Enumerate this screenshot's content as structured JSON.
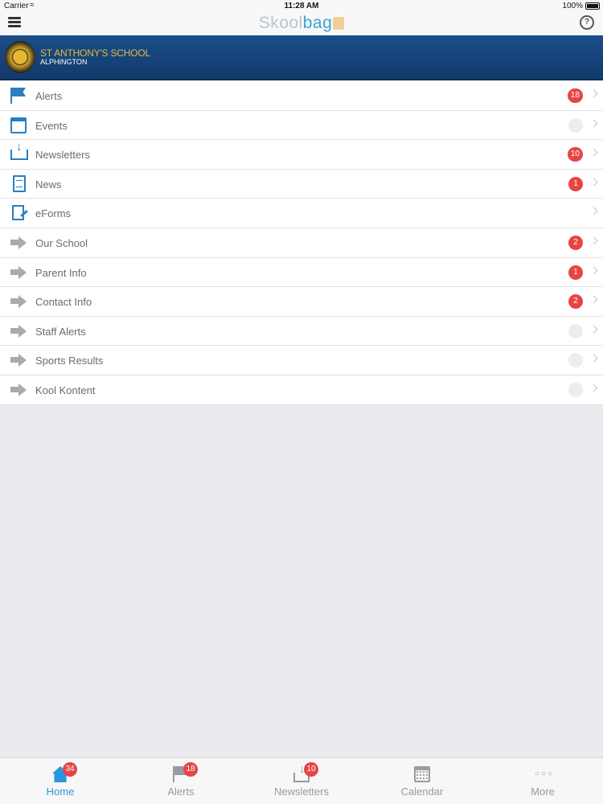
{
  "status_bar": {
    "carrier": "Carrier",
    "time": "11:28 AM",
    "battery": "100%"
  },
  "nav": {
    "logo_part1": "Skool",
    "logo_part2": "bag",
    "menu_icon": "hamburger-icon",
    "help_icon": "help-icon"
  },
  "school": {
    "name": "ST ANTHONY'S SCHOOL",
    "suburb": "ALPHINGTON"
  },
  "menu": [
    {
      "label": "Alerts",
      "icon": "flag-icon",
      "badge": "18"
    },
    {
      "label": "Events",
      "icon": "calendar-icon",
      "badge": ""
    },
    {
      "label": "Newsletters",
      "icon": "inbox-download-icon",
      "badge": "10"
    },
    {
      "label": "News",
      "icon": "document-icon",
      "badge": "1"
    },
    {
      "label": "eForms",
      "icon": "form-edit-icon",
      "badge": null
    },
    {
      "label": "Our School",
      "icon": "arrow-right-icon",
      "badge": "2"
    },
    {
      "label": "Parent Info",
      "icon": "arrow-right-icon",
      "badge": "1"
    },
    {
      "label": "Contact Info",
      "icon": "arrow-right-icon",
      "badge": "2"
    },
    {
      "label": "Staff Alerts",
      "icon": "arrow-right-icon",
      "badge": ""
    },
    {
      "label": "Sports Results",
      "icon": "arrow-right-icon",
      "badge": ""
    },
    {
      "label": "Kool Kontent",
      "icon": "arrow-right-icon",
      "badge": ""
    }
  ],
  "tabs": [
    {
      "label": "Home",
      "icon": "home-icon",
      "badge": "34",
      "active": true
    },
    {
      "label": "Alerts",
      "icon": "flag-icon",
      "badge": "18",
      "active": false
    },
    {
      "label": "Newsletters",
      "icon": "inbox-download-icon",
      "badge": "10",
      "active": false
    },
    {
      "label": "Calendar",
      "icon": "calendar-icon",
      "badge": null,
      "active": false
    },
    {
      "label": "More",
      "icon": "more-dots-icon",
      "badge": null,
      "active": false
    }
  ],
  "colors": {
    "accent": "#2b96e0",
    "badge": "#e74545",
    "banner": "#1a4e8a",
    "school_name": "#e7b93a"
  }
}
